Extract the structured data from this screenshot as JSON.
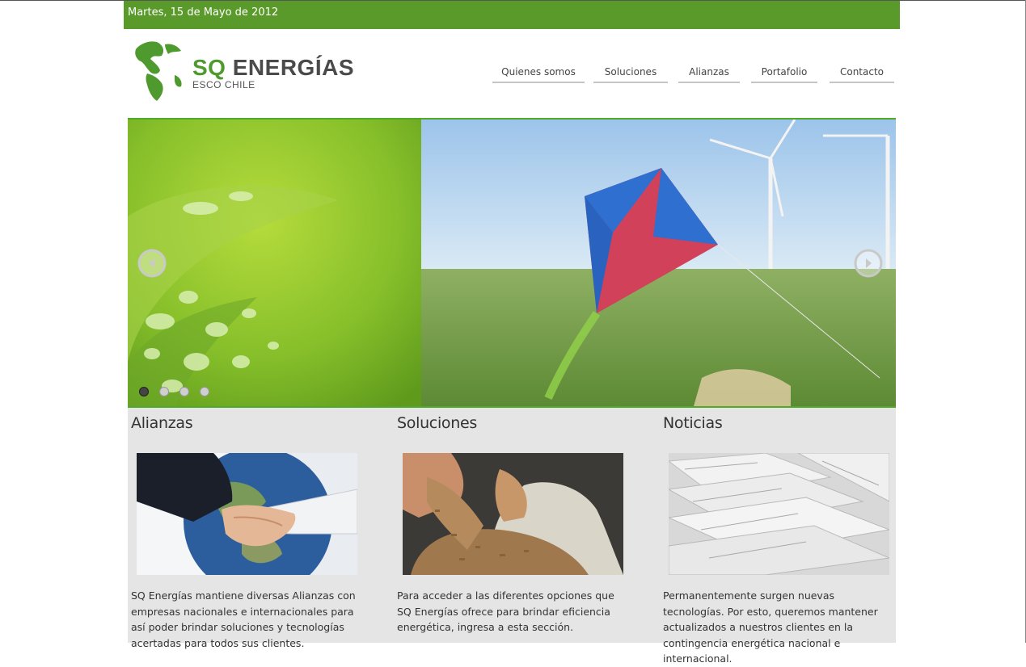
{
  "header": {
    "date": "Martes, 15 de Mayo de 2012",
    "logo_main_1": "SQ",
    "logo_main_2": "ENERGÍAS",
    "logo_sub": "ESCO CHILE"
  },
  "nav": {
    "items": [
      {
        "label": "Quienes somos"
      },
      {
        "label": "Soluciones"
      },
      {
        "label": "Alianzas"
      },
      {
        "label": "Portafolio"
      },
      {
        "label": "Contacto"
      }
    ]
  },
  "slider": {
    "prev_icon": "chevron-left-icon",
    "next_icon": "chevron-right-icon",
    "dots_count": 4,
    "active_dot": 0
  },
  "sections": [
    {
      "title": "Alianzas",
      "image": "handshake-globe-image",
      "text": "SQ Energías mantiene diversas Alianzas con empresas nacionales e internacionales para así poder brindar soluciones y tecnologías acertadas para todos sus clientes."
    },
    {
      "title": "Soluciones",
      "image": "wood-pellets-image",
      "text": "Para acceder a las diferentes opciones que SQ Energías ofrece para brindar eficiencia energética, ingresa a esta sección."
    },
    {
      "title": "Noticias",
      "image": "newspapers-image",
      "text": "Permanentemente surgen nuevas tecnologías. Por esto, queremos mantener actualizados a nuestros clientes en la contingencia energética nacional e internacional."
    }
  ],
  "colors": {
    "brand_green": "#5a9a2a",
    "accent_green": "#4faa2c",
    "text_dark": "#333333",
    "panel_bg": "#e5e5e5"
  }
}
